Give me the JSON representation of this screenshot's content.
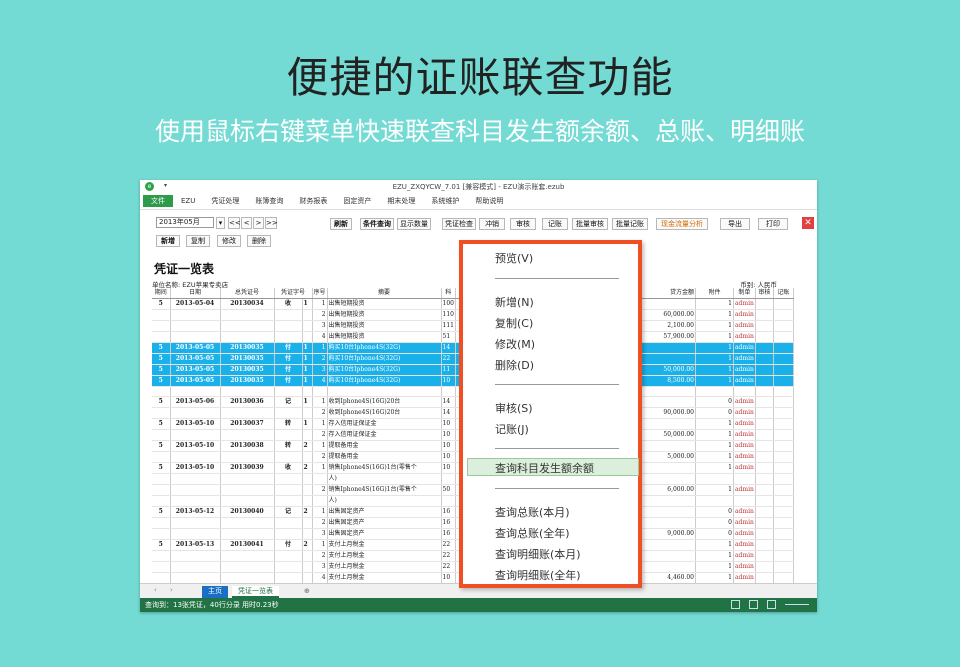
{
  "headline": "便捷的证账联查功能",
  "subline": "使用鼠标右键菜单快速联查科目发生额余额、总账、明细账",
  "window": {
    "title": "EZU_ZXQYCW_7.01  [兼容模式] - EZU演示账套.ezub",
    "menu": [
      "文件",
      "EZU",
      "凭证处理",
      "账簿查询",
      "财务报表",
      "固定资产",
      "期末处理",
      "系统维护",
      "帮助说明"
    ],
    "period": "2013年05月",
    "nav_buttons": [
      "<<",
      "<",
      ">",
      ">>"
    ],
    "left_buttons": [
      "新增",
      "复制",
      "修改",
      "删除"
    ],
    "toolbar_buttons": [
      "刷新",
      "条件查询",
      "显示数量",
      "凭证检查",
      "冲销",
      "审核",
      "记账",
      "批量审核",
      "批量记账",
      "现金流量分析",
      "导出",
      "打印"
    ],
    "close": "✕"
  },
  "sheet": {
    "title": "凭证一览表",
    "unit": "单位名称: EZU苹果专卖店",
    "currency": "币别: 人民币",
    "headers": [
      "期间",
      "日期",
      "总凭证号",
      "凭证字号",
      "序号",
      "摘要",
      "科",
      "贷方金额",
      "附件",
      "制单",
      "审核",
      "记账"
    ],
    "rows": [
      {
        "p": "5",
        "d": "2013-05-04",
        "n": "20130034",
        "z": "收",
        "zn": "1",
        "s": "1",
        "m": "出售短期投资",
        "k": "100",
        "cr": "",
        "f": "1",
        "u": "admin",
        "g": 1,
        "sel": 0
      },
      {
        "p": "",
        "d": "",
        "n": "",
        "z": "",
        "zn": "",
        "s": "2",
        "m": "出售短期投资",
        "k": "110",
        "cr": "60,000.00",
        "f": "1",
        "u": "admin",
        "g": 0,
        "sel": 0
      },
      {
        "p": "",
        "d": "",
        "n": "",
        "z": "",
        "zn": "",
        "s": "3",
        "m": "出售短期投资",
        "k": "111",
        "cr": "2,100.00",
        "f": "1",
        "u": "admin",
        "g": 0,
        "sel": 0
      },
      {
        "p": "",
        "d": "",
        "n": "",
        "z": "",
        "zn": "",
        "s": "4",
        "m": "出售短期投资",
        "k": "51",
        "cr": "57,900.00",
        "f": "1",
        "u": "admin",
        "g": 0,
        "sel": 0
      },
      {
        "p": "5",
        "d": "2013-05-05",
        "n": "20130035",
        "z": "付",
        "zn": "1",
        "s": "1",
        "m": "购买10台Iphone4S(32G)",
        "k": "14",
        "cr": "",
        "f": "1",
        "u": "admin",
        "g": 1,
        "sel": 1
      },
      {
        "p": "5",
        "d": "2013-05-05",
        "n": "20130035",
        "z": "付",
        "zn": "1",
        "s": "2",
        "m": "购买10台Iphone4S(32G)",
        "k": "22",
        "cr": "",
        "f": "1",
        "u": "admin",
        "g": 0,
        "sel": 1
      },
      {
        "p": "5",
        "d": "2013-05-05",
        "n": "20130035",
        "z": "付",
        "zn": "1",
        "s": "3",
        "m": "购买10台Iphone4S(32G)",
        "k": "11",
        "cr": "50,000.00",
        "f": "1",
        "u": "admin",
        "g": 0,
        "sel": 1
      },
      {
        "p": "5",
        "d": "2013-05-05",
        "n": "20130035",
        "z": "付",
        "zn": "1",
        "s": "4",
        "m": "购买10台Iphone4S(32G)",
        "k": "10",
        "cr": "8,500.00",
        "f": "1",
        "u": "admin",
        "g": 0,
        "sel": 1
      },
      {
        "p": "",
        "d": "",
        "n": "",
        "z": "",
        "zn": "",
        "s": "",
        "m": "",
        "k": "",
        "cr": "",
        "f": "",
        "u": "",
        "g": 0,
        "sel": 0
      },
      {
        "p": "5",
        "d": "2013-05-06",
        "n": "20130036",
        "z": "记",
        "zn": "1",
        "s": "1",
        "m": "收到Iphone4S(16G)20台",
        "k": "14",
        "cr": "",
        "f": "0",
        "u": "admin",
        "g": 1,
        "sel": 0
      },
      {
        "p": "",
        "d": "",
        "n": "",
        "z": "",
        "zn": "",
        "s": "2",
        "m": "收到Iphone4S(16G)20台",
        "k": "14",
        "cr": "90,000.00",
        "f": "0",
        "u": "admin",
        "g": 0,
        "sel": 0
      },
      {
        "p": "5",
        "d": "2013-05-10",
        "n": "20130037",
        "z": "转",
        "zn": "1",
        "s": "1",
        "m": "存入信用证保证金",
        "k": "10",
        "cr": "",
        "f": "1",
        "u": "admin",
        "g": 1,
        "sel": 0
      },
      {
        "p": "",
        "d": "",
        "n": "",
        "z": "",
        "zn": "",
        "s": "2",
        "m": "存入信用证保证金",
        "k": "10",
        "cr": "50,000.00",
        "f": "1",
        "u": "admin",
        "g": 0,
        "sel": 0
      },
      {
        "p": "5",
        "d": "2013-05-10",
        "n": "20130038",
        "z": "转",
        "zn": "2",
        "s": "1",
        "m": "提取备用金",
        "k": "10",
        "cr": "",
        "f": "1",
        "u": "admin",
        "g": 1,
        "sel": 0
      },
      {
        "p": "",
        "d": "",
        "n": "",
        "z": "",
        "zn": "",
        "s": "2",
        "m": "提取备用金",
        "k": "10",
        "cr": "5,000.00",
        "f": "1",
        "u": "admin",
        "g": 0,
        "sel": 0
      },
      {
        "p": "5",
        "d": "2013-05-10",
        "n": "20130039",
        "z": "收",
        "zn": "2",
        "s": "1",
        "m": "销售Iphone4S(16G)1台(零售个",
        "k": "10",
        "cr": "",
        "f": "1",
        "u": "admin",
        "g": 1,
        "sel": 0
      },
      {
        "p": "",
        "d": "",
        "n": "",
        "z": "",
        "zn": "",
        "s": "",
        "m": "人)",
        "k": "",
        "cr": "",
        "f": "",
        "u": "",
        "g": 0,
        "sel": 0
      },
      {
        "p": "",
        "d": "",
        "n": "",
        "z": "",
        "zn": "",
        "s": "2",
        "m": "销售Iphone4S(16G)1台(零售个",
        "k": "50",
        "cr": "6,000.00",
        "f": "1",
        "u": "admin",
        "g": 0,
        "sel": 0
      },
      {
        "p": "",
        "d": "",
        "n": "",
        "z": "",
        "zn": "",
        "s": "",
        "m": "人)",
        "k": "",
        "cr": "",
        "f": "",
        "u": "",
        "g": 0,
        "sel": 0
      },
      {
        "p": "5",
        "d": "2013-05-12",
        "n": "20130040",
        "z": "记",
        "zn": "2",
        "s": "1",
        "m": "出售固定资产",
        "k": "16",
        "cr": "",
        "f": "0",
        "u": "admin",
        "g": 1,
        "sel": 0
      },
      {
        "p": "",
        "d": "",
        "n": "",
        "z": "",
        "zn": "",
        "s": "2",
        "m": "出售固定资产",
        "k": "16",
        "cr": "",
        "f": "0",
        "u": "admin",
        "g": 0,
        "sel": 0
      },
      {
        "p": "",
        "d": "",
        "n": "",
        "z": "",
        "zn": "",
        "s": "3",
        "m": "出售固定资产",
        "k": "16",
        "cr": "9,000.00",
        "f": "0",
        "u": "admin",
        "g": 0,
        "sel": 0
      },
      {
        "p": "5",
        "d": "2013-05-13",
        "n": "20130041",
        "z": "付",
        "zn": "2",
        "s": "1",
        "m": "支付上月税金",
        "k": "22",
        "cr": "",
        "f": "1",
        "u": "admin",
        "g": 1,
        "sel": 0
      },
      {
        "p": "",
        "d": "",
        "n": "",
        "z": "",
        "zn": "",
        "s": "2",
        "m": "支付上月税金",
        "k": "22",
        "cr": "",
        "f": "1",
        "u": "admin",
        "g": 0,
        "sel": 0
      },
      {
        "p": "",
        "d": "",
        "n": "",
        "z": "",
        "zn": "",
        "s": "3",
        "m": "支付上月税金",
        "k": "22",
        "cr": "",
        "f": "1",
        "u": "admin",
        "g": 0,
        "sel": 0
      },
      {
        "p": "",
        "d": "",
        "n": "",
        "z": "",
        "zn": "",
        "s": "4",
        "m": "支付上月税金",
        "k": "10",
        "cr": "4,460.00",
        "f": "1",
        "u": "admin",
        "g": 0,
        "sel": 0
      }
    ]
  },
  "tabs": {
    "home": "主页",
    "active": "凭证一览表",
    "add": "⊕"
  },
  "status": "查询到：13张凭证，40行分录    用时0.23秒",
  "context_menu": {
    "items": [
      "预览(V)",
      "新增(N)",
      "复制(C)",
      "修改(M)",
      "删除(D)",
      "审核(S)",
      "记账(J)",
      "查询科目发生额余额",
      "查询总账(本月)",
      "查询总账(全年)",
      "查询明细账(本月)",
      "查询明细账(全年)"
    ],
    "highlighted": "查询科目发生额余额"
  }
}
